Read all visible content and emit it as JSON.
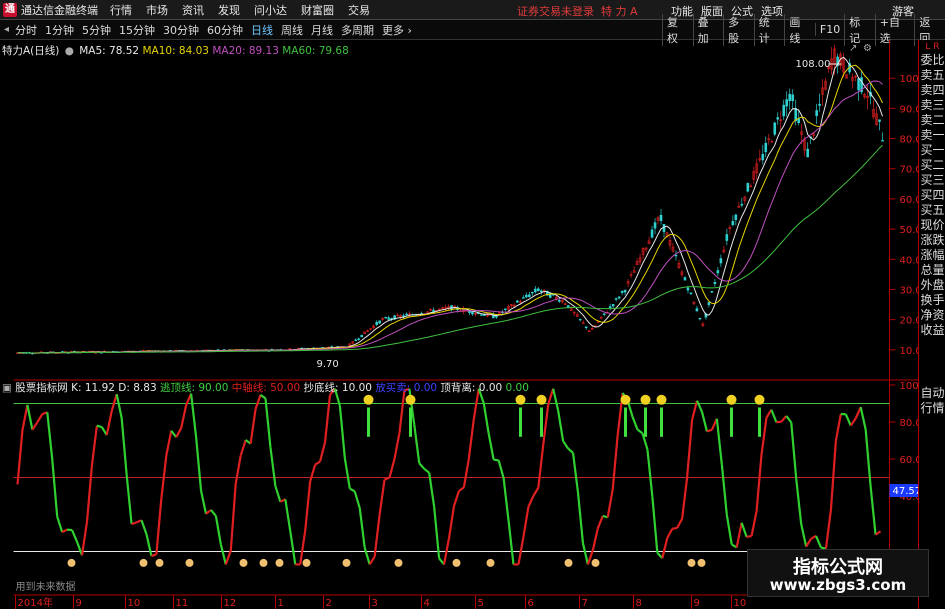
{
  "app": {
    "title": "通达信金融终端",
    "menu": [
      "行情",
      "市场",
      "资讯",
      "发现",
      "问小达",
      "财富圈",
      "交易"
    ],
    "login_hint": "证券交易未登录",
    "stock_name": "特 力 A",
    "right_menu": [
      "功能",
      "版面",
      "公式",
      "选项"
    ],
    "guest": "游客"
  },
  "toolbar": {
    "timeframes": [
      "分时",
      "1分钟",
      "5分钟",
      "15分钟",
      "30分钟",
      "60分钟",
      "日线",
      "周线",
      "月线",
      "多周期",
      "更多"
    ],
    "active": "日线",
    "right_buttons": [
      "复权",
      "叠加",
      "多股",
      "统计",
      "画线",
      "F10",
      "标记",
      "+自选",
      "返回"
    ]
  },
  "main_chart": {
    "title": "特力A(日线)",
    "ma": [
      {
        "label": "MA5: 78.52",
        "color": "#e8e8e8"
      },
      {
        "label": "MA10: 84.03",
        "color": "#e6d400"
      },
      {
        "label": "MA20: 89.13",
        "color": "#c050c0"
      },
      {
        "label": "MA60: 79.68",
        "color": "#40c040"
      }
    ],
    "y_ticks": [
      "100.00",
      "90.00",
      "80.00",
      "70.00",
      "60.00",
      "50.00",
      "40.00",
      "30.00",
      "20.00",
      "10.00"
    ],
    "high_label": "108.00",
    "low_label": "9.70"
  },
  "indicator": {
    "title": "股票指标网",
    "items": [
      {
        "label": "K: 11.92",
        "color": "#e8e8e8"
      },
      {
        "label": "D: 8.83",
        "color": "#e8e8e8"
      },
      {
        "label": "逃顶线: 90.00",
        "color": "#40d040"
      },
      {
        "label": "中轴线: 50.00",
        "color": "#e02020"
      },
      {
        "label": "抄底线: 10.00",
        "color": "#e8e8e8"
      },
      {
        "label": "放买卖: 0.00",
        "color": "#4040ff"
      },
      {
        "label": "顶背离: 0.00",
        "color": "#e8e8e8"
      },
      {
        "label": "0.00",
        "color": "#40d040"
      }
    ],
    "y_ticks": [
      "100.0",
      "80.00",
      "60.00",
      "40.00"
    ],
    "current_value": "47.57",
    "bottom_note": "用到未来数据"
  },
  "x_axis": [
    "2014年",
    "9",
    "10",
    "11",
    "12",
    "1",
    "2",
    "3",
    "4",
    "5",
    "6",
    "7",
    "8",
    "9",
    "10"
  ],
  "right_panel": [
    "委比",
    "卖五",
    "卖四",
    "卖三",
    "卖二",
    "卖一",
    "买一",
    "买二",
    "买三",
    "买四",
    "买五",
    "现价",
    "涨跌",
    "涨幅",
    "总量",
    "外盘",
    "换手",
    "净资",
    "收益"
  ],
  "right_panel_bottom": [
    "自动",
    "行情"
  ],
  "watermark": {
    "title": "指标公式网",
    "url": "www.zbgs3.com"
  },
  "colors": {
    "up": "#e02020",
    "down": "#30d030",
    "grid": "#8b0000",
    "axis": "#b00000"
  }
}
